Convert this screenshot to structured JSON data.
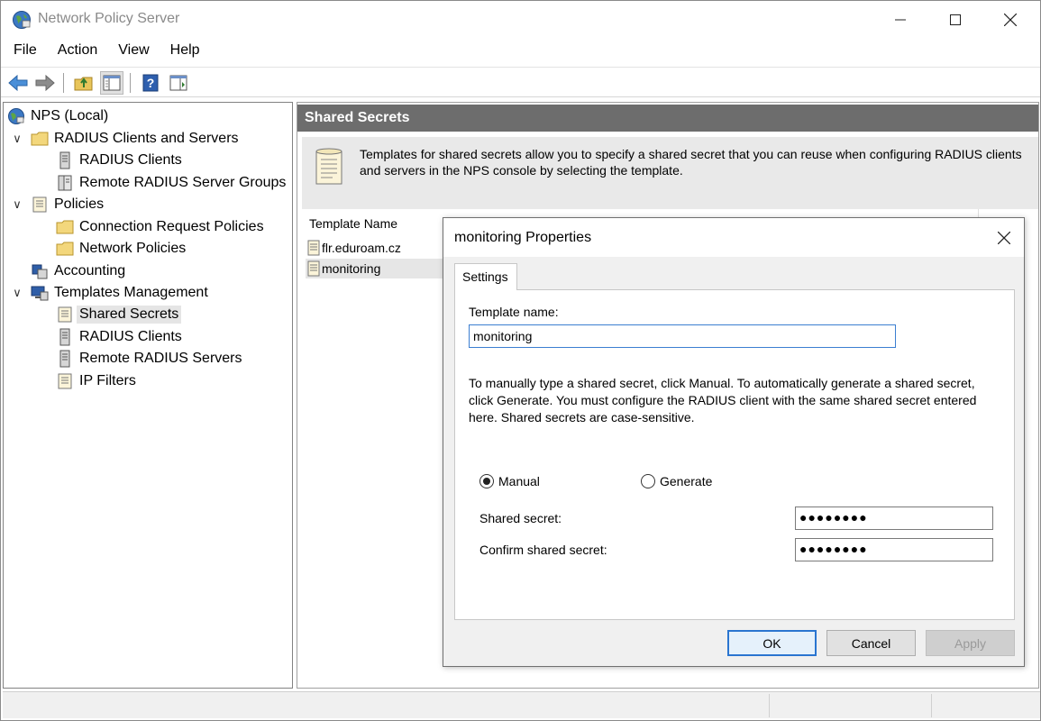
{
  "window": {
    "title": "Network Policy Server",
    "controls": {
      "minimize": "—",
      "maximize": "☐",
      "close": "✕"
    }
  },
  "menu": [
    "File",
    "Action",
    "View",
    "Help"
  ],
  "toolbar": [
    "back-arrow-icon",
    "forward-arrow-icon",
    "up-folder-icon",
    "show-hide-tree-icon",
    "help-icon",
    "properties-icon"
  ],
  "tree": {
    "root": "NPS (Local)",
    "items": [
      {
        "label": "RADIUS Clients and Servers",
        "expanded": true
      },
      {
        "label": "RADIUS Clients"
      },
      {
        "label": "Remote RADIUS Server Groups"
      },
      {
        "label": "Policies",
        "expanded": true
      },
      {
        "label": "Connection Request Policies"
      },
      {
        "label": "Network Policies"
      },
      {
        "label": "Accounting"
      },
      {
        "label": "Templates Management",
        "expanded": true
      },
      {
        "label": "Shared Secrets",
        "selected": true
      },
      {
        "label": "RADIUS Clients"
      },
      {
        "label": "Remote RADIUS Servers"
      },
      {
        "label": "IP Filters"
      }
    ]
  },
  "main": {
    "header": "Shared Secrets",
    "info": "Templates for shared secrets allow you to specify a shared secret that you can reuse when configuring RADIUS clients and servers in the NPS console by selecting the template.",
    "column": "Template Name",
    "rows": [
      "flr.eduroam.cz",
      "monitoring"
    ]
  },
  "dialog": {
    "title": "monitoring Properties",
    "close": "✕",
    "tab": "Settings",
    "name_label": "Template name:",
    "name_value": "monitoring",
    "description": "To manually type a shared secret, click Manual. To automatically generate a shared secret, click Generate. You must configure the RADIUS client with the same shared secret entered here. Shared secrets are case-sensitive.",
    "radio_manual": "Manual",
    "radio_generate": "Generate",
    "selected_mode": "Manual",
    "secret_label": "Shared secret:",
    "secret_value": "●●●●●●●●",
    "confirm_label": "Confirm shared secret:",
    "confirm_value": "●●●●●●●●",
    "buttons": {
      "ok": "OK",
      "cancel": "Cancel",
      "apply": "Apply"
    }
  },
  "colors": {
    "header_bg": "#6d6d6d",
    "info_bg": "#e9e9e9",
    "dialog_bg": "#f0f0f0",
    "focus_border": "#3c7fd1",
    "default_button": "#2a75d0"
  }
}
